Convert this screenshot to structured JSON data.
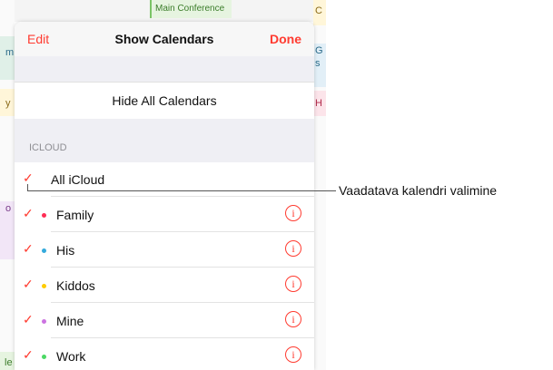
{
  "background": {
    "event_main_conference": "Main Conference",
    "fragment_m": "m",
    "fragment_o": "o",
    "fragment_y": "y",
    "fragment_le": "le",
    "fragment_g": "G",
    "fragment_s": "s",
    "fragment_h": "H",
    "fragment_c": "C"
  },
  "navbar": {
    "edit_label": "Edit",
    "title": "Show Calendars",
    "done_label": "Done"
  },
  "hide_all_label": "Hide All Calendars",
  "section_header": "ICLOUD",
  "all_icloud_label": "All iCloud",
  "calendars": [
    {
      "label": "Family",
      "color": "#ff2d55"
    },
    {
      "label": "His",
      "color": "#34aadc"
    },
    {
      "label": "Kiddos",
      "color": "#ffcc00"
    },
    {
      "label": "Mine",
      "color": "#cc73e1"
    },
    {
      "label": "Work",
      "color": "#4cd964"
    }
  ],
  "check_glyph": "✓",
  "info_glyph": "i",
  "accent_color": "#ff3b30",
  "callout_text": "Vaadatava kalendri valimine"
}
